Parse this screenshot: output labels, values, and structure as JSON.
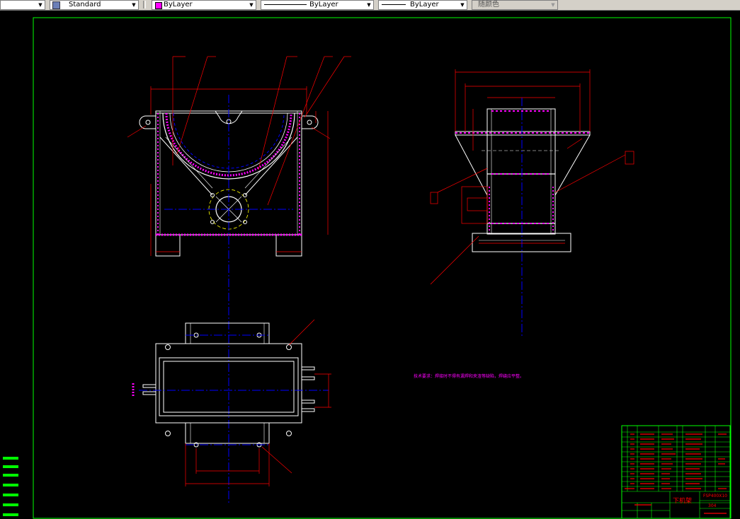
{
  "toolbar": {
    "text_style": "Standard",
    "layer_color": "ByLayer",
    "layer_color_hex": "#ff00ff",
    "linetype": "ByLayer",
    "lineweight": "ByLayer",
    "plot_style": "随颜色"
  },
  "drawing": {
    "note_text": "技术要求：焊接时不得有漏焊和夹渣等缺陷，焊缝应平整。",
    "title_block": {
      "name": "下机架",
      "drawing_number": "FSP400X10",
      "material": "304"
    }
  },
  "colors": {
    "background": "#000000",
    "frame": "#00ff00",
    "outline": "#ffffff",
    "dimension": "#ff0000",
    "centerline": "#0000ff",
    "hatch": "#ff00ff"
  }
}
